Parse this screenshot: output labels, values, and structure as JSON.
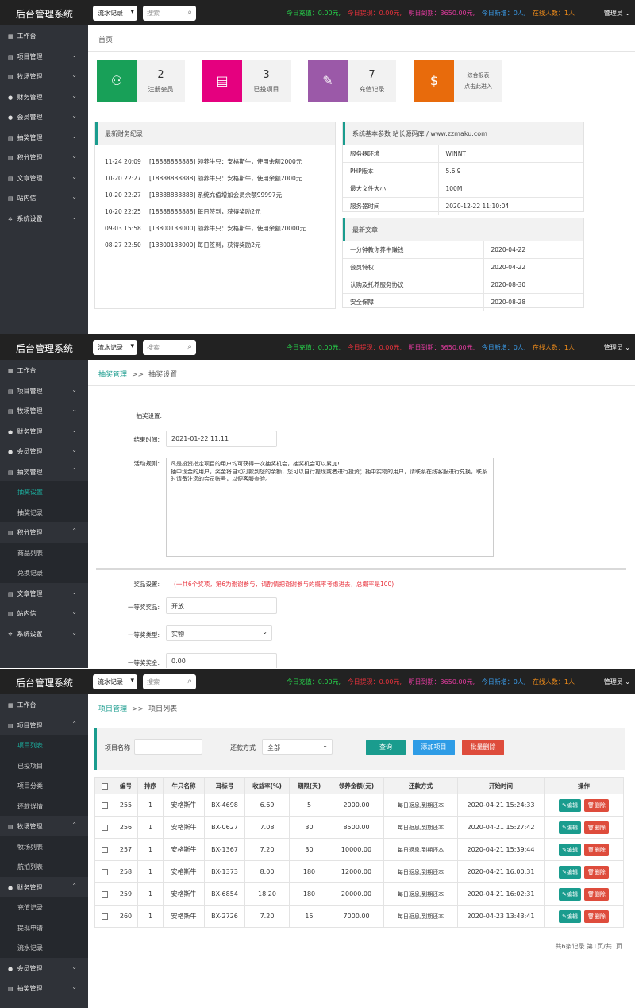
{
  "app_title": "后台管理系统",
  "topbar": {
    "select_value": "流水记录",
    "search_placeholder": "搜索",
    "stats": {
      "recharge": "今日充值：0.00元,",
      "withdraw": "今日提现：0.00元,",
      "due": "明日到期：3650.00元,",
      "new_users": "今日新增：0人,",
      "online": "在线人数：1人"
    },
    "admin": "管理员"
  },
  "colors": {
    "accent": "#1a9c8e",
    "green": "#18a058",
    "pink": "#e5007f",
    "purple": "#9b59a8",
    "orange": "#e86b0c",
    "blue": "#2e9ce6",
    "red": "#de4c3c"
  },
  "sidebar1": [
    {
      "label": "工作台",
      "icon": "grid-icon"
    },
    {
      "label": "项目管理"
    },
    {
      "label": "牧场管理"
    },
    {
      "label": "财务管理"
    },
    {
      "label": "会员管理"
    },
    {
      "label": "抽奖管理"
    },
    {
      "label": "积分管理"
    },
    {
      "label": "文章管理"
    },
    {
      "label": "站内信"
    },
    {
      "label": "系统设置"
    }
  ],
  "sidebar2": [
    {
      "label": "工作台"
    },
    {
      "label": "项目管理"
    },
    {
      "label": "牧场管理"
    },
    {
      "label": "财务管理"
    },
    {
      "label": "会员管理"
    },
    {
      "label": "抽奖管理"
    },
    {
      "label": "抽奖设置"
    },
    {
      "label": "抽奖记录"
    },
    {
      "label": "积分管理"
    },
    {
      "label": "商品列表"
    },
    {
      "label": "兑换记录"
    },
    {
      "label": "文章管理"
    },
    {
      "label": "站内信"
    },
    {
      "label": "系统设置"
    }
  ],
  "sidebar3": [
    {
      "label": "工作台"
    },
    {
      "label": "项目管理"
    },
    {
      "label": "项目列表"
    },
    {
      "label": "已投项目"
    },
    {
      "label": "项目分类"
    },
    {
      "label": "还款详情"
    },
    {
      "label": "牧场管理"
    },
    {
      "label": "牧场列表"
    },
    {
      "label": "航拍列表"
    },
    {
      "label": "财务管理"
    },
    {
      "label": "充值记录"
    },
    {
      "label": "提现申请"
    },
    {
      "label": "流水记录"
    },
    {
      "label": "会员管理"
    },
    {
      "label": "抽奖管理"
    }
  ],
  "dashboard": {
    "breadcrumb": "首页",
    "cards": [
      {
        "num": "2",
        "label": "注册会员"
      },
      {
        "num": "3",
        "label": "已投项目"
      },
      {
        "num": "7",
        "label": "充值记录"
      },
      {
        "line1": "综合报表",
        "line2": "点击此进入"
      }
    ],
    "finance_title": "最新财务纪录",
    "finance": [
      {
        "time": "11-24 20:09",
        "text": "[18888888888] 领养牛只：安格斯牛，使用余额2000元"
      },
      {
        "time": "10-20 22:27",
        "text": "[18888888888] 领养牛只：安格斯牛，使用余额2000元"
      },
      {
        "time": "10-20 22:27",
        "text": "[18888888888] 系统充值增加会员余额99997元"
      },
      {
        "time": "10-20 22:25",
        "text": "[18888888888] 每日签到，获得奖励2元"
      },
      {
        "time": "09-03 15:58",
        "text": "[13800138000] 领养牛只：安格斯牛，使用余额20000元"
      },
      {
        "time": "08-27 22:50",
        "text": "[13800138000] 每日签到，获得奖励2元"
      }
    ],
    "sysinfo_title": "系统基本参数 站长源码库 / www.zzmaku.com",
    "sysinfo": [
      {
        "k": "服务器环境",
        "v": "WINNT"
      },
      {
        "k": "PHP版本",
        "v": "5.6.9"
      },
      {
        "k": "最大文件大小",
        "v": "100M"
      },
      {
        "k": "服务器时间",
        "v": "2020-12-22 11:10:04"
      }
    ],
    "articles_title": "最新文章",
    "articles": [
      {
        "k": "一分钟教你养牛赚钱",
        "v": "2020-04-22"
      },
      {
        "k": "会员特权",
        "v": "2020-04-22"
      },
      {
        "k": "认购及托养服务协议",
        "v": "2020-08-30"
      },
      {
        "k": "安全保障",
        "v": "2020-08-28"
      }
    ]
  },
  "lottery": {
    "crumb_link": "抽奖管理",
    "crumb_sep": ">>",
    "crumb_current": "抽奖设置",
    "section_label": "抽奖设置:",
    "end_label": "结束时间:",
    "end_value": "2021-01-22 11:11",
    "rules_label": "活动规则:",
    "rules_text": "凡是投资指定项目的用户均可获得一次抽奖机会，抽奖机会可以累加!\n抽中现金的用户，奖金将自动打款到您的余额，您可以自行提现或者进行投资；抽中实物的用户，请联系在线客服进行兑换，联系时请备注您的会员账号，以便客服查验。",
    "prize_label": "奖品设置:",
    "prize_note": "(一共6个奖项，第6为谢谢参与，请酌情把谢谢参与的概率考虑进去，总概率是100)",
    "first_prize_label": "一等奖奖品:",
    "first_prize_value": "开放",
    "first_type_label": "一等奖类型:",
    "first_type_value": "实物",
    "first_amount_label": "一等奖奖金:",
    "first_amount_value": "0.00"
  },
  "projects": {
    "crumb_link": "项目管理",
    "crumb_sep": ">>",
    "crumb_current": "项目列表",
    "name_label": "项目名称",
    "repay_label": "还款方式",
    "repay_value": "全部",
    "query_btn": "查询",
    "add_btn": "添加项目",
    "bulk_delete_btn": "批量删除",
    "columns": [
      "编号",
      "排序",
      "牛只名称",
      "耳标号",
      "收益率(%)",
      "期限(天)",
      "领养金额(元)",
      "还款方式",
      "开始时间",
      "操作"
    ],
    "rows": [
      [
        "255",
        "1",
        "安格斯牛",
        "BX-4698",
        "6.69",
        "5",
        "2000.00",
        "每日返息,到期还本",
        "2020-04-21 15:24:33"
      ],
      [
        "256",
        "1",
        "安格斯牛",
        "BX-0627",
        "7.08",
        "30",
        "8500.00",
        "每日返息,到期还本",
        "2020-04-21 15:27:42"
      ],
      [
        "257",
        "1",
        "安格斯牛",
        "BX-1367",
        "7.20",
        "30",
        "10000.00",
        "每日返息,到期还本",
        "2020-04-21 15:39:44"
      ],
      [
        "258",
        "1",
        "安格斯牛",
        "BX-1373",
        "8.00",
        "180",
        "12000.00",
        "每日返息,到期还本",
        "2020-04-21 16:00:31"
      ],
      [
        "259",
        "1",
        "安格斯牛",
        "BX-6854",
        "18.20",
        "180",
        "20000.00",
        "每日返息,到期还本",
        "2020-04-21 16:02:31"
      ],
      [
        "260",
        "1",
        "安格斯牛",
        "BX-2726",
        "7.20",
        "15",
        "7000.00",
        "每日返息,到期还本",
        "2020-04-23 13:43:41"
      ]
    ],
    "edit_label": "编辑",
    "delete_label": "删除",
    "pager_text": "共6条记录 第1页/共1页"
  }
}
